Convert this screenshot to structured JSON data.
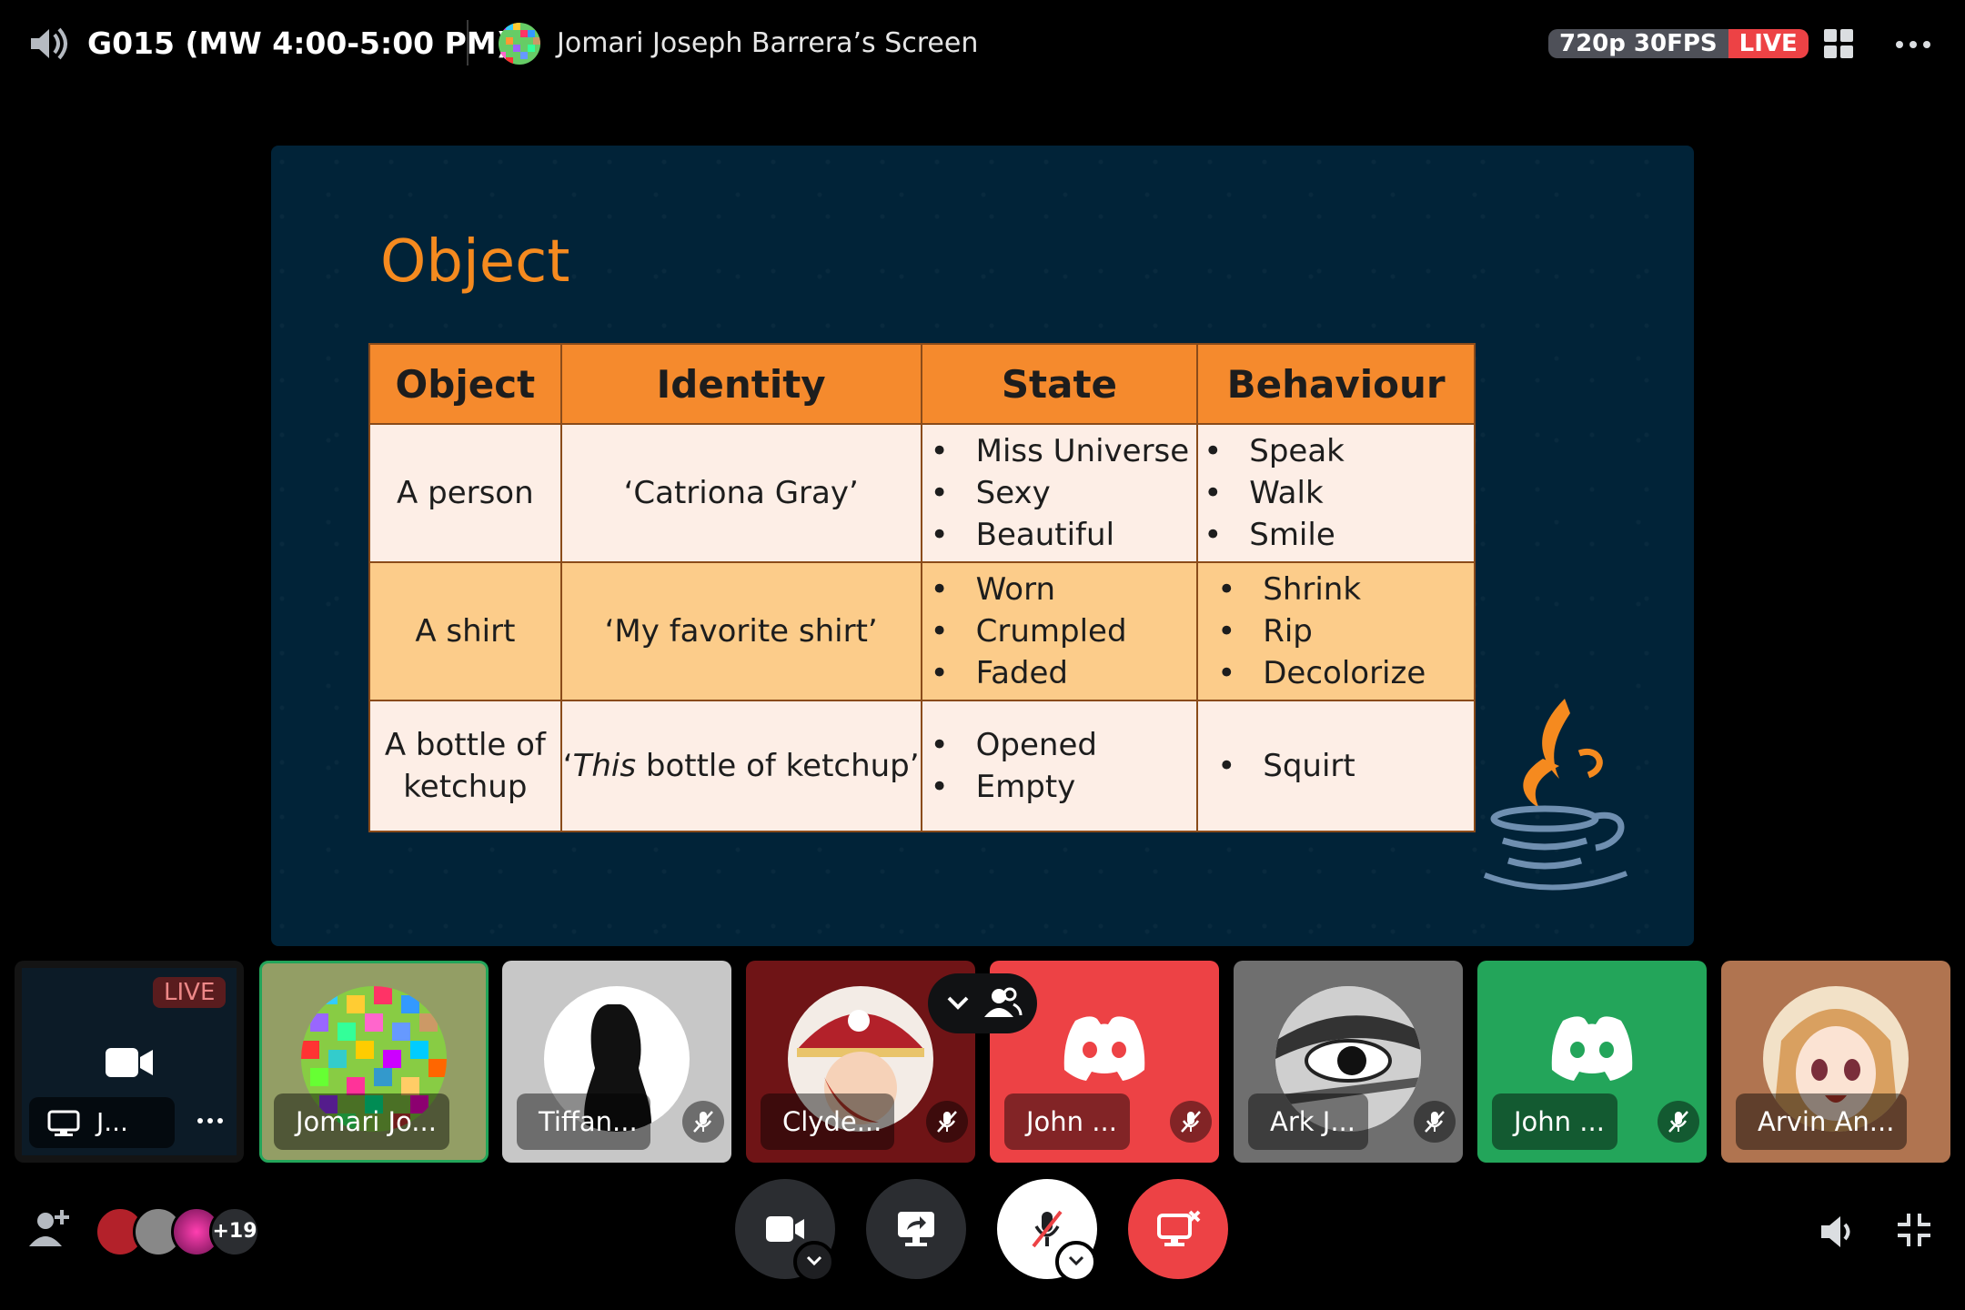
{
  "header": {
    "channel_title": "G015 (MW 4:00-5:00 PM)",
    "stream_label": "Jomari Joseph Barrera’s Screen",
    "quality": "720p 30FPS",
    "live_badge": "LIVE"
  },
  "slide": {
    "title": "Object",
    "columns": [
      "Object",
      "Identity",
      "State",
      "Behaviour"
    ],
    "rows": [
      {
        "object": "A person",
        "identity": "‘Catriona Gray’",
        "state": [
          "Miss Universe",
          "Sexy",
          "Beautiful"
        ],
        "behaviour": [
          "Speak",
          "Walk",
          "Smile"
        ]
      },
      {
        "object": "A shirt",
        "identity": "‘My favorite shirt’",
        "state": [
          "Worn",
          "Crumpled",
          "Faded"
        ],
        "behaviour": [
          "Shrink",
          "Rip",
          "Decolorize"
        ]
      },
      {
        "object_line1": "A bottle of",
        "object_line2": "ketchup",
        "identity_prefix": "‘",
        "identity_em": "This",
        "identity_suffix": " bottle of ketchup’",
        "state": [
          "Opened",
          "Empty"
        ],
        "behaviour": [
          "Squirt"
        ]
      }
    ]
  },
  "tiles": {
    "stream_preview": {
      "live": "LIVE",
      "name": "J..."
    },
    "me": {
      "name": "Jomari Jo..."
    },
    "tiffany": {
      "name": "Tiffan..."
    },
    "clyde": {
      "name": "Clyde..."
    },
    "john1": {
      "name": "John ..."
    },
    "ark": {
      "name": "Ark J..."
    },
    "john2": {
      "name": "John ..."
    },
    "arvin": {
      "name": "Arvin An..."
    }
  },
  "footer": {
    "extra_participants": "+19"
  },
  "colors": {
    "accent_green": "#23a55a",
    "danger_red": "#ed4245",
    "slide_orange": "#f58a1f",
    "slide_bg": "#012338"
  },
  "icons": [
    "speaker-icon",
    "grid-icon",
    "more-icon",
    "camera-icon",
    "share-screen-icon",
    "mic-muted-icon",
    "leave-stream-icon",
    "invite-icon",
    "volume-icon",
    "minimize-icon",
    "discord-icon",
    "chevron-down-icon",
    "people-icon",
    "monitor-icon"
  ]
}
